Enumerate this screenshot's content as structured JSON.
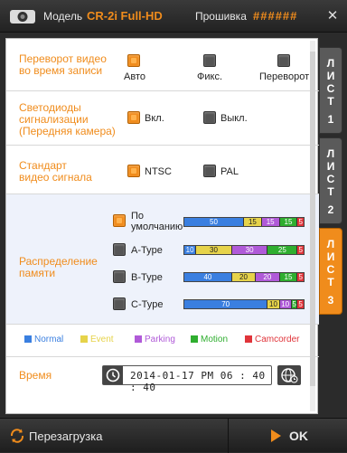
{
  "header": {
    "model_label": "Модель",
    "model_value": "CR-2i Full-HD",
    "firmware_label": "Прошивка",
    "firmware_value": "######",
    "close_symbol": "✕"
  },
  "flip": {
    "title": "Переворот видео\nво время записи",
    "options": [
      {
        "label": "Авто",
        "checked": true
      },
      {
        "label": "Фикс.",
        "checked": false
      },
      {
        "label": "Переворот",
        "checked": false
      }
    ]
  },
  "led": {
    "title": "Светодиоды\nсигнализации\n(Передняя камера)",
    "options": [
      {
        "label": "Вкл.",
        "checked": true
      },
      {
        "label": "Выкл.",
        "checked": false
      }
    ]
  },
  "video_standard": {
    "title": "Стандарт\nвидео сигнала",
    "options": [
      {
        "label": "NTSC",
        "checked": true
      },
      {
        "label": "PAL",
        "checked": false
      }
    ]
  },
  "memory": {
    "title": "Распределение\nпамяти",
    "rows": [
      {
        "label": "По\nумолчанию",
        "checked": true,
        "segments": [
          50,
          15,
          15,
          15,
          5
        ]
      },
      {
        "label": "A-Type",
        "checked": false,
        "segments": [
          10,
          30,
          30,
          25,
          5
        ]
      },
      {
        "label": "B-Type",
        "checked": false,
        "segments": [
          40,
          20,
          20,
          15,
          5
        ]
      },
      {
        "label": "C-Type",
        "checked": false,
        "segments": [
          70,
          10,
          10,
          5,
          5
        ]
      }
    ],
    "legend": [
      {
        "label": "Normal",
        "color": "#3a7fe0"
      },
      {
        "label": "Event",
        "color": "#e6d34a"
      },
      {
        "label": "Parking",
        "color": "#b05ad8"
      },
      {
        "label": "Motion",
        "color": "#2fae2f"
      },
      {
        "label": "Camcorder",
        "color": "#e0343a"
      }
    ]
  },
  "time": {
    "title": "Время",
    "value": "2014-01-17  PM  06 : 40 : 40"
  },
  "tabs": [
    {
      "letters": [
        "Л",
        "И",
        "С",
        "Т",
        "1"
      ],
      "active": false
    },
    {
      "letters": [
        "Л",
        "И",
        "С",
        "Т",
        "2"
      ],
      "active": false
    },
    {
      "letters": [
        "Л",
        "И",
        "С",
        "Т",
        "3"
      ],
      "active": true
    }
  ],
  "footer": {
    "reboot_label": "Перезагрузка",
    "ok_label": "OK"
  },
  "colors": {
    "accent": "#f08c1c"
  }
}
